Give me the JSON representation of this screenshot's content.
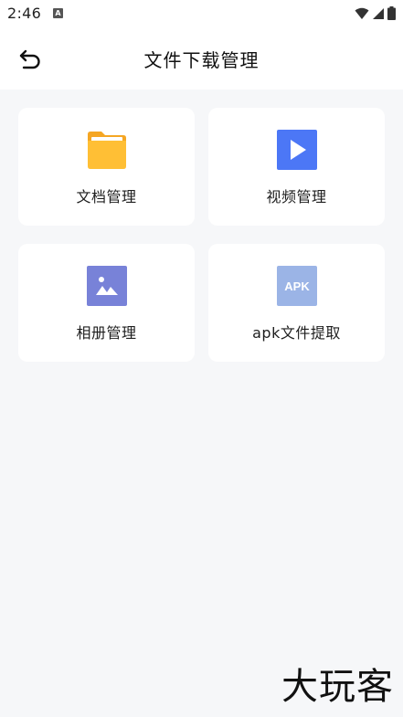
{
  "status_bar": {
    "time": "2:46",
    "app_icon_letter": "A",
    "icons": [
      "wifi-icon",
      "signal-icon",
      "battery-icon"
    ]
  },
  "header": {
    "title": "文件下载管理",
    "back_icon": "back-arrow-icon"
  },
  "cards": [
    {
      "label": "文档管理",
      "icon": "folder-icon",
      "color": "#FFB72B"
    },
    {
      "label": "视频管理",
      "icon": "video-play-icon",
      "color": "#4C77F6"
    },
    {
      "label": "相册管理",
      "icon": "image-icon",
      "color": "#7882D8"
    },
    {
      "label": "apk文件提取",
      "icon": "apk-icon",
      "icon_text": "APK",
      "color": "#9BB4E6"
    }
  ],
  "watermark": "大玩客",
  "colors": {
    "background": "#F6F7F9",
    "card": "#FFFFFF"
  }
}
